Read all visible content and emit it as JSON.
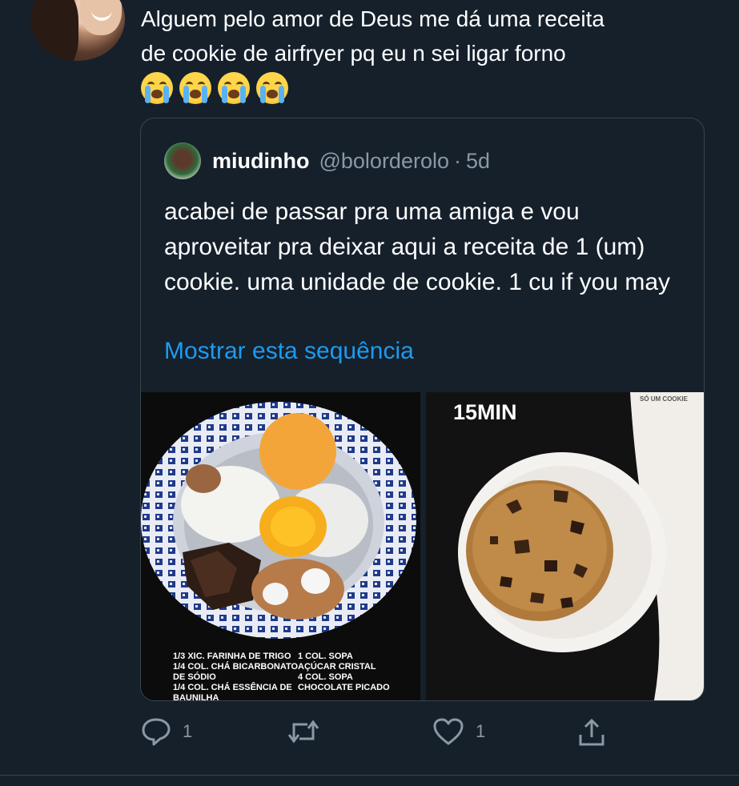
{
  "tweet": {
    "text_line1": "Alguem pelo amor de Deus me dá uma receita",
    "text_line2": "de cookie de airfryer pq eu n sei ligar forno",
    "emoji_name": "loudly-crying-face",
    "emoji_count": 4
  },
  "quoted": {
    "name": "miudinho",
    "handle": "@bolorderolo",
    "separator": "·",
    "time": "5d",
    "body": "acabei de passar pra uma amiga e vou aproveitar pra deixar aqui a receita de 1 (um) cookie. uma unidade de cookie. 1 cu if you may",
    "show_thread": "Mostrar esta sequência",
    "media_left": {
      "recipe_col1": [
        "1/3 XIC. FARINHA DE TRIGO",
        "1/4 COL. CHÁ BICARBONATO",
        "DE SÓDIO",
        "1/4 COL. CHÁ ESSÊNCIA DE",
        "BAUNILHA"
      ],
      "recipe_col2": [
        "1 COL. SOPA",
        "AÇÚCAR CRISTAL",
        "4 COL. SOPA",
        "CHOCOLATE PICADO"
      ]
    },
    "media_right": {
      "time_label": "15MIN",
      "caption": "SÓ UM COOKIE"
    }
  },
  "actions": {
    "reply_count": "1",
    "retweet_count": "",
    "like_count": "1"
  },
  "colors": {
    "background": "#15202b",
    "text": "#ffffff",
    "secondary": "#8b98a5",
    "link": "#1d9bf0",
    "border": "#38444d"
  }
}
